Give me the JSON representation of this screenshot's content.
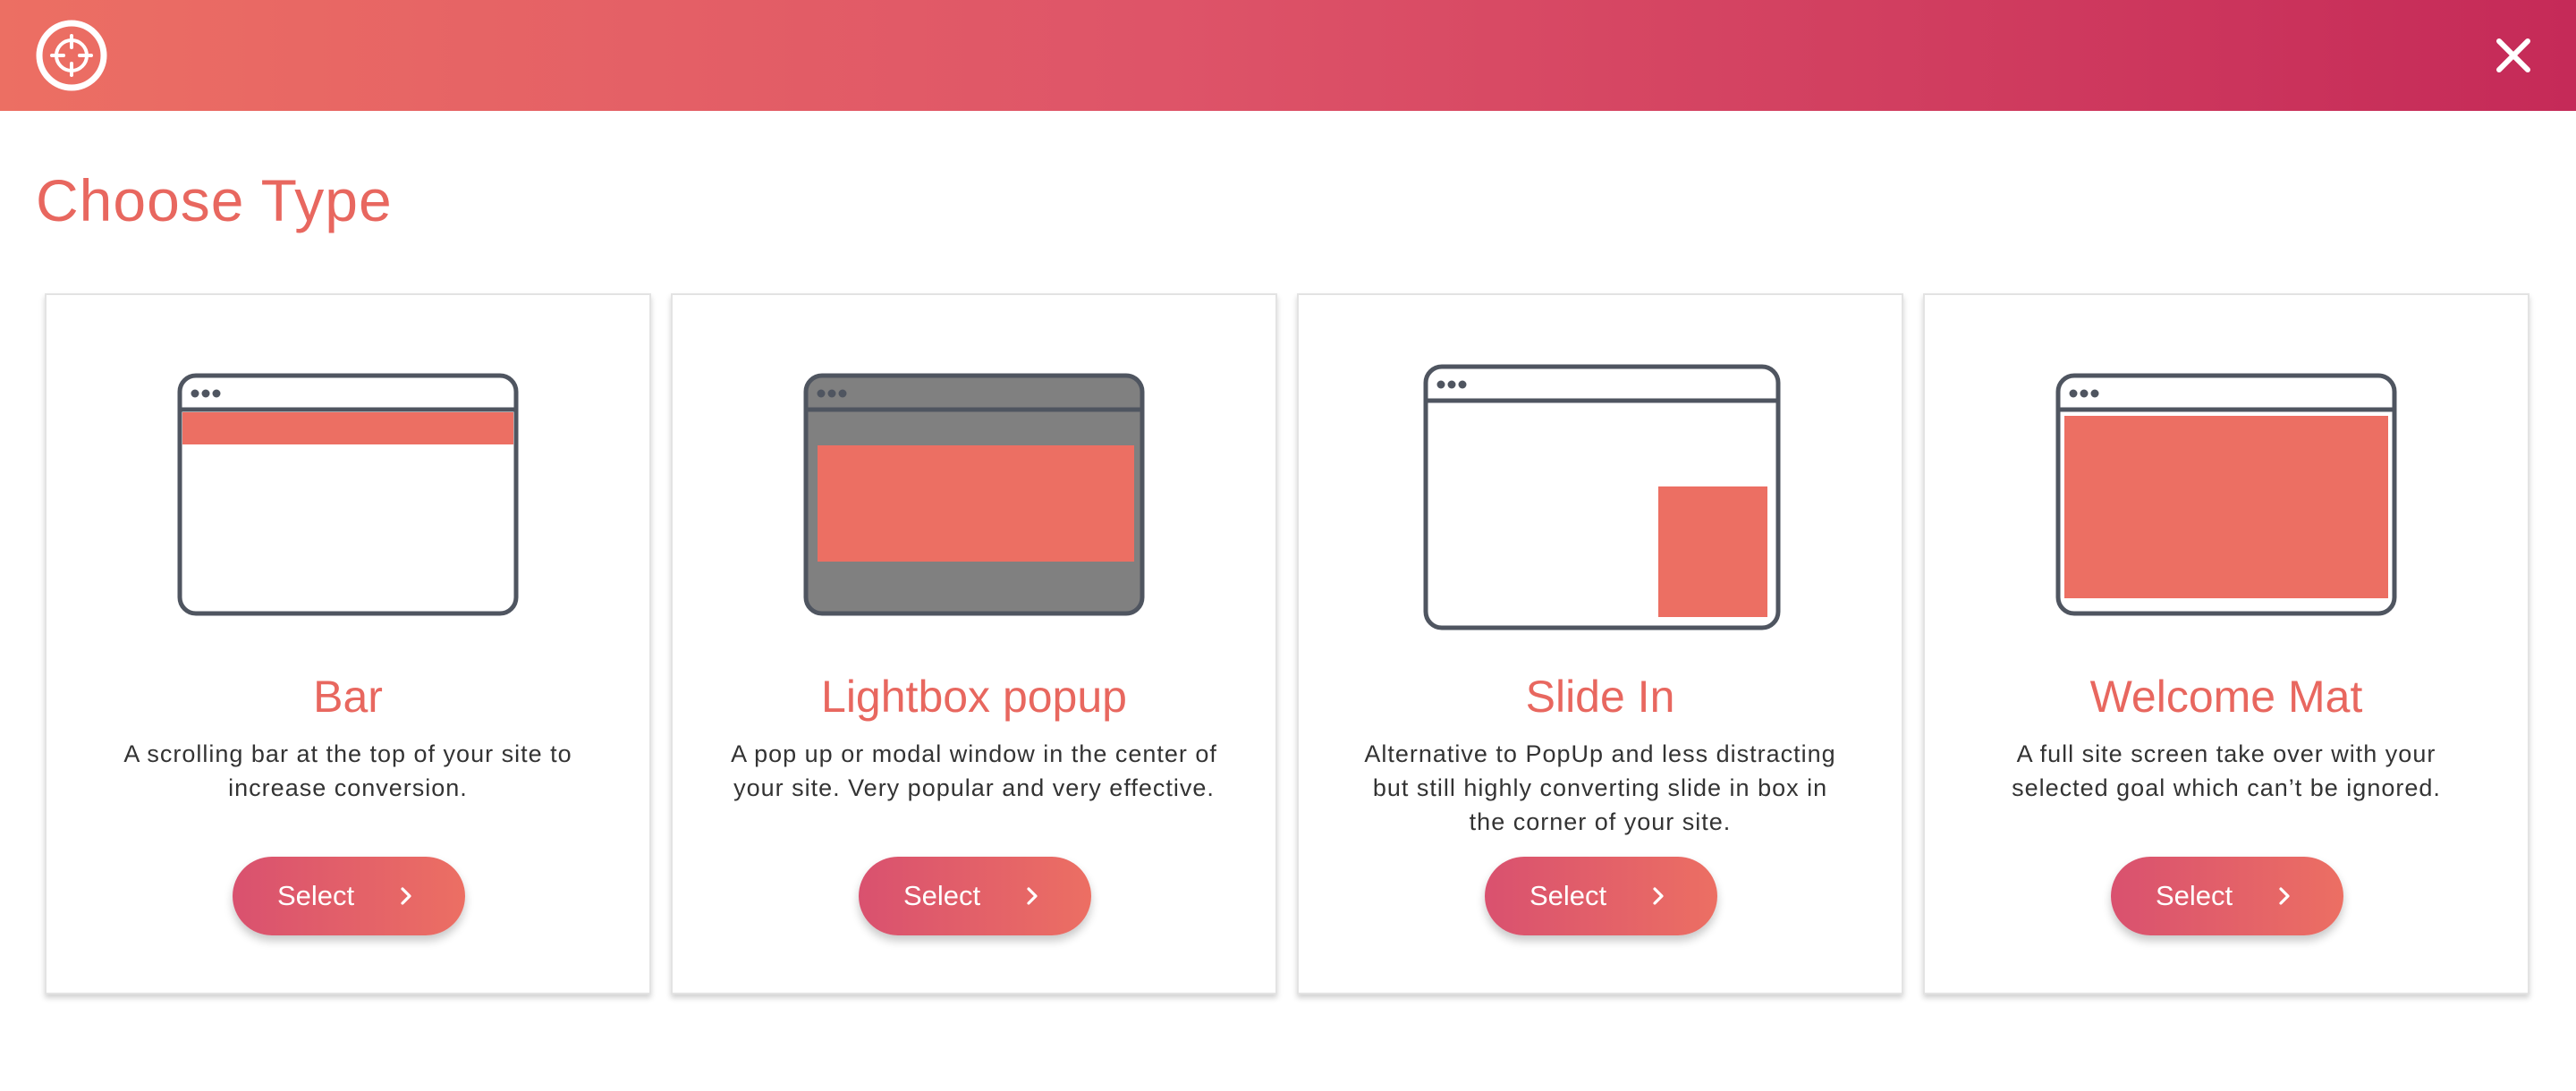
{
  "header": {
    "logo_icon": "target-icon",
    "close_icon": "close-icon",
    "gradient_colors": [
      "#ec6f63",
      "#c52a58"
    ]
  },
  "page": {
    "title": "Choose Type"
  },
  "accent_color": "#e8675f",
  "cards": [
    {
      "id": "bar",
      "title": "Bar",
      "description": "A scrolling bar at the top of your site to increase conversion.",
      "button_label": "Select",
      "illustration": "browser-bar-illustration"
    },
    {
      "id": "lightbox",
      "title": "Lightbox popup",
      "description": "A pop up or modal window in the center of your site. Very popular and very effective.",
      "button_label": "Select",
      "illustration": "browser-lightbox-illustration"
    },
    {
      "id": "slidein",
      "title": "Slide In",
      "description": "Alternative to PopUp and less distracting but still highly converting slide in box in the corner of your site.",
      "button_label": "Select",
      "illustration": "browser-slidein-illustration"
    },
    {
      "id": "welcomemat",
      "title": "Welcome Mat",
      "description": "A full site screen take over with your selected goal which can’t be ignored.",
      "button_label": "Select",
      "illustration": "browser-welcomemat-illustration"
    }
  ]
}
